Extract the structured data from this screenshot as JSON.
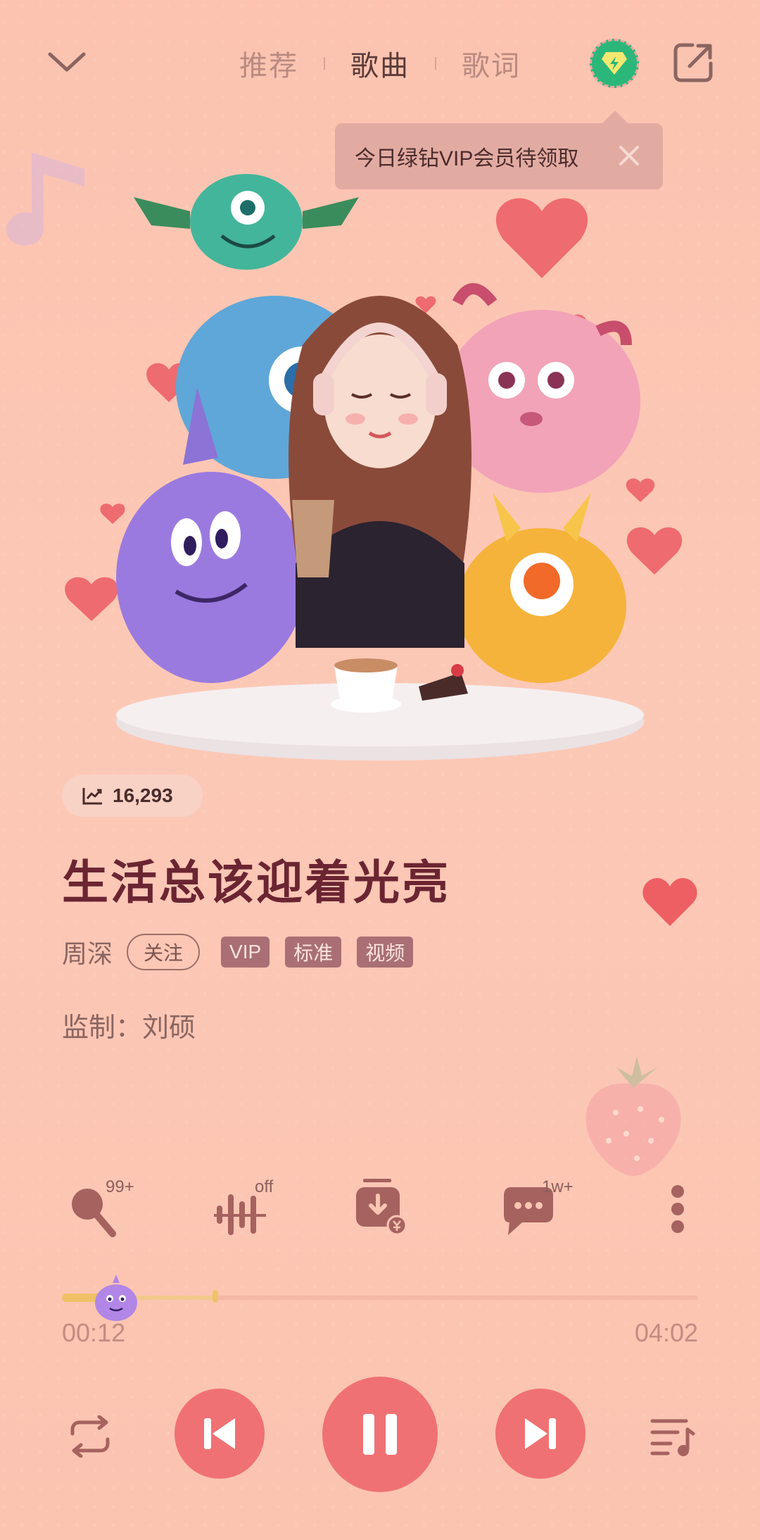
{
  "header": {
    "tabs": [
      {
        "label": "推荐"
      },
      {
        "label": "歌曲"
      },
      {
        "label": "歌词"
      }
    ],
    "active_tab": "歌曲"
  },
  "tooltip": {
    "text": "今日绿钻VIP会员待领取"
  },
  "song": {
    "play_count": "16,293",
    "title": "生活总该迎着光亮",
    "artist": "周深",
    "follow_label": "关注",
    "tags": [
      "VIP",
      "标准",
      "视频"
    ],
    "producer": "监制：刘硕"
  },
  "actions": {
    "karaoke_count": "99+",
    "effect_state": "off",
    "comment_count": "1w+"
  },
  "progress": {
    "current": "00:12",
    "total": "04:02",
    "played_fraction": 0.05,
    "buffered_fraction": 0.24
  },
  "colors": {
    "background": "#fbc5b3",
    "accent": "#f07173",
    "title": "#6b2532",
    "vip_green": "#2cb77a"
  }
}
